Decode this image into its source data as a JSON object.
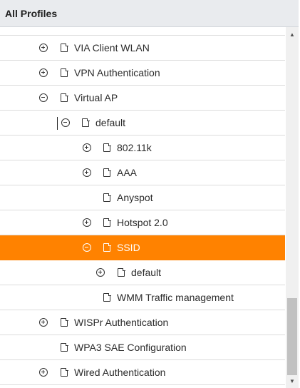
{
  "header": {
    "title": "All Profiles"
  },
  "tree": {
    "rows": [
      {
        "label": "VIA Client WLAN",
        "toggle": "plus",
        "selected": false
      },
      {
        "label": "VPN Authentication",
        "toggle": "plus",
        "selected": false
      },
      {
        "label": "Virtual AP",
        "toggle": "minus",
        "selected": false
      },
      {
        "label": "default",
        "toggle": "minus",
        "selected": false
      },
      {
        "label": "802.11k",
        "toggle": "plus",
        "selected": false
      },
      {
        "label": "AAA",
        "toggle": "plus",
        "selected": false
      },
      {
        "label": "Anyspot",
        "toggle": "none",
        "selected": false
      },
      {
        "label": "Hotspot 2.0",
        "toggle": "plus",
        "selected": false
      },
      {
        "label": "SSID",
        "toggle": "minus",
        "selected": true
      },
      {
        "label": "default",
        "toggle": "plus",
        "selected": false
      },
      {
        "label": "WMM Traffic management",
        "toggle": "none",
        "selected": false
      },
      {
        "label": "WISPr Authentication",
        "toggle": "plus",
        "selected": false
      },
      {
        "label": "WPA3 SAE Configuration",
        "toggle": "none",
        "selected": false
      },
      {
        "label": "Wired Authentication",
        "toggle": "plus",
        "selected": false
      }
    ]
  },
  "scrollbar": {
    "up_arrow": "▲",
    "down_arrow": "▼"
  },
  "icons": {
    "expand": "plus-circle-icon",
    "collapse": "minus-circle-icon",
    "profile": "document-icon"
  },
  "colors": {
    "selected_bg": "#ff8200",
    "header_bg": "#e9ebee"
  }
}
